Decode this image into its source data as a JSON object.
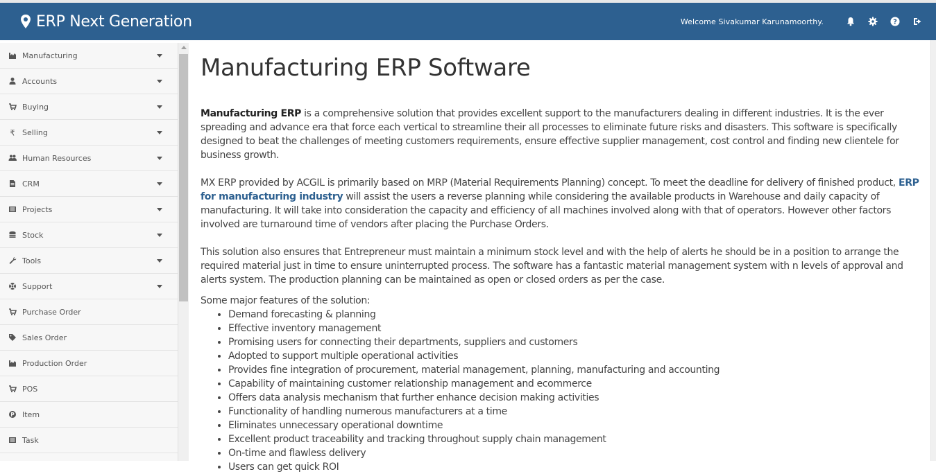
{
  "header": {
    "brand": "ERP Next Generation",
    "welcome": "Welcome  Sivakumar  Karunamoorthy.",
    "icons": [
      "bell-icon",
      "gear-icon",
      "help-icon",
      "signout-icon"
    ]
  },
  "sidebar": {
    "items": [
      {
        "label": "Manufacturing",
        "icon": "chart-icon",
        "expandable": true
      },
      {
        "label": "Accounts",
        "icon": "user-icon",
        "expandable": true
      },
      {
        "label": "Buying",
        "icon": "cart-icon",
        "expandable": true
      },
      {
        "label": "Selling",
        "icon": "rupee-icon",
        "expandable": true
      },
      {
        "label": "Human Resources",
        "icon": "users-icon",
        "expandable": true
      },
      {
        "label": "CRM",
        "icon": "file-icon",
        "expandable": true
      },
      {
        "label": "Projects",
        "icon": "list-icon",
        "expandable": true
      },
      {
        "label": "Stock",
        "icon": "database-icon",
        "expandable": true
      },
      {
        "label": "Tools",
        "icon": "wrench-icon",
        "expandable": true
      },
      {
        "label": "Support",
        "icon": "lifebuoy-icon",
        "expandable": true
      },
      {
        "label": "Purchase Order",
        "icon": "cart-icon",
        "expandable": false
      },
      {
        "label": "Sales Order",
        "icon": "tags-icon",
        "expandable": false
      },
      {
        "label": "Production Order",
        "icon": "chart-icon",
        "expandable": false
      },
      {
        "label": "POS",
        "icon": "cart-icon",
        "expandable": false
      },
      {
        "label": "Item",
        "icon": "product-icon",
        "expandable": false
      },
      {
        "label": "Task",
        "icon": "list-icon",
        "expandable": false
      }
    ]
  },
  "main": {
    "title": "Manufacturing ERP Software",
    "p1_bold": "Manufacturing ERP",
    "p1_rest": " is a comprehensive solution that provides excellent support to the manufacturers dealing in different industries. It is the ever spreading and advance era that force each vertical to streamline their all processes to eliminate future risks and disasters. This software is specifically designed to beat the challenges of meeting customers requirements, ensure effective supplier management, cost control and finding new clientele for business growth.",
    "p2_start": "MX ERP provided by ACGIL is primarily based on MRP (Material Requirements Planning) concept. To meet the deadline for delivery of finished product, ",
    "p2_link": "ERP for manufacturing industry",
    "p2_end": " will assist the users a reverse planning while considering the available products in Warehouse and daily capacity of manufacturing. It will take into consideration the capacity and efficiency of all machines involved along with that of operators. However other factors involved are turnaround time of vendors after placing the Purchase Orders.",
    "p3": "This solution also ensures that Entrepreneur must maintain a minimum stock level and with the help of alerts he should be in a position to arrange the required material just in time to ensure uninterrupted process. The software has a fantastic material management system with n levels of approval and alerts system. The production planning can be maintained as open or closed orders as per the case.",
    "features_intro": "Some major features of the solution:",
    "features": [
      "Demand forecasting & planning",
      "Effective inventory management",
      "Promising users for connecting their departments, suppliers and customers",
      "Adopted to support multiple operational activities",
      "Provides fine integration of procurement, material management, planning, manufacturing and accounting",
      "Capability of maintaining customer relationship management and ecommerce",
      "Offers data analysis mechanism that further enhance decision making activities",
      "Functionality of handling numerous manufacturers at a time",
      "Eliminates unnecessary operational downtime",
      "Excellent product traceability and tracking throughout supply chain management",
      "On-time and flawless delivery",
      "Users can get quick ROI"
    ]
  }
}
